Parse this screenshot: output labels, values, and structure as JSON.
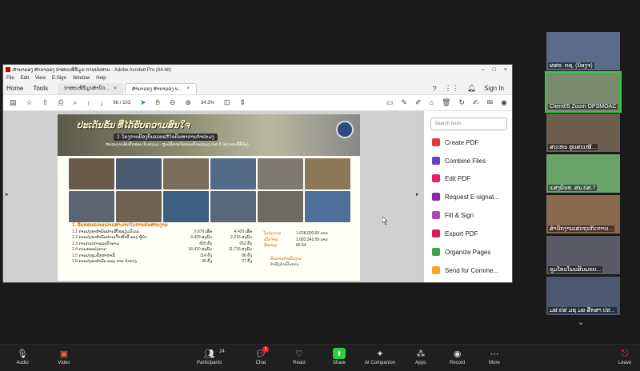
{
  "acrobat": {
    "window_title": "ສຳນາລອງ ສຳນາລອງ ນຳສະເໜີຂໍ້ມູນ ການປະສານ - Adobe Acrobat Pro (64-bit)",
    "menu": [
      "File",
      "Edit",
      "View",
      "E-Sign",
      "Window",
      "Help"
    ],
    "nav": [
      "Home",
      "Tools"
    ],
    "tabs": [
      {
        "label": "ນຳສະເໜີຂໍ້ມູນສຳນັກ..."
      },
      {
        "label": "ສຳນາລອງ ສຳນາລອງ ນ..."
      }
    ],
    "sign_in": "Sign In",
    "page_current": "96",
    "page_total": "/ 103",
    "zoom": "34.3%",
    "search_tools_placeholder": "Search tools",
    "tools": [
      "Create PDF",
      "Combine Files",
      "Edit PDF",
      "Request E-signat...",
      "Fill & Sign",
      "Export PDF",
      "Organize Pages",
      "Send for Comme..."
    ]
  },
  "poster": {
    "banner_title": "ປະເດັນຂັ້ນ ທີ່ໄດ້ຮັບຄວາມສົນໃຈ",
    "banner_sub": "2. ໂຄງການປ້ອງກັນແລະແກ້ໄຂປັນຫາການກໍາປະມງ",
    "banner_sub2": "ຫນ່ວຍງານຮັບຜິດຊອບ ກົມປະມງ - ສູນບໍລິການຈັດການດ້ານປະມງ ເຂດ 8 (ປະຈວບຄີຣີຂັນ)",
    "section_header": "1. ຂັ້ນຕອນແລະຄວາມສາມາດໃນການປະສານງານ",
    "rows": [
      {
        "label": "1.1 ການປະຊາສໍາພັນຜ່ານສື່ໂຊຊຽວມີເດຍ",
        "v1": "5,670 ເທື່ອ",
        "v2": "4,420 ເທື່ອ"
      },
      {
        "label": "1.2 ການປະຊາສໍາພັນຜ່ານເຈົ້າໜ້າທີ່ ແລະ ຜູ້ນໍາ",
        "v1": "3,429 ສະບັບ",
        "v2": "2,215 ສະບັບ"
      },
      {
        "label": "1.3 ການກວດກາແລະຕິດຕາມ",
        "v1": "805 ຄັ້ງ",
        "v2": "652 ຄັ້ງ"
      },
      {
        "label": "1.4 ການອອກປະກາດ",
        "v1": "16,410 ສະບັບ",
        "v2": "11,716 ສະບັບ"
      },
      {
        "label": "1.5 ການປະຊຸມປຶກສາຫາລື",
        "v1": "114 ຄັ້ງ",
        "v2": "86 ຄັ້ງ"
      },
      {
        "label": "1.6 ການປະຊາສໍາພັນ ແລະ ການ ກໍາກາງ",
        "v1": "36 ຄັ້ງ",
        "v2": "27 ຄັ້ງ"
      }
    ],
    "budget_labels": [
      "ງົບປະມານ",
      "ເບີກຈ່າຍ",
      "ຮ້ອຍລະ"
    ],
    "budget_values": [
      "1,628,000.00 ບາດ",
      "1,083,342.59 ບາດ",
      "66.54"
    ],
    "plan_label": "ຜົນການດໍາເນີນງານ",
    "plan_value": "ກໍາລັງດໍາເນີນການ"
  },
  "participants": [
    {
      "name": "ຜສຮ. ກຊ. (ນ້ອງຈ)"
    },
    {
      "name": "Client05 Zoom OPSMOAC"
    },
    {
      "name": "ສະເຫນ ຮູບສະເໜີ..."
    },
    {
      "name": "ແສງພັນທ. ສນ.ປສ.7"
    },
    {
      "name": "ສໍານັກງານເສດຖະກິດການ..."
    },
    {
      "name": "ຊຸມໂທນໂພນສົນພຣບ..."
    },
    {
      "name": "ມສ.ຢສ ມຊ ມລ ສຶກສາ ປຮ..."
    }
  ],
  "zoom_bar": {
    "audio": "Audio",
    "video": "Video",
    "participants": "Participants",
    "participants_count": "24",
    "chat": "Chat",
    "chat_badge": "1",
    "react": "React",
    "share": "Share",
    "ai": "AI Companion",
    "apps": "Apps",
    "record": "Record",
    "more": "More",
    "leave": "Leave"
  },
  "colors": {
    "zoom_green": "#2ecc40",
    "poster_accent": "#d97706",
    "acrobat_red": "#cc0000"
  }
}
